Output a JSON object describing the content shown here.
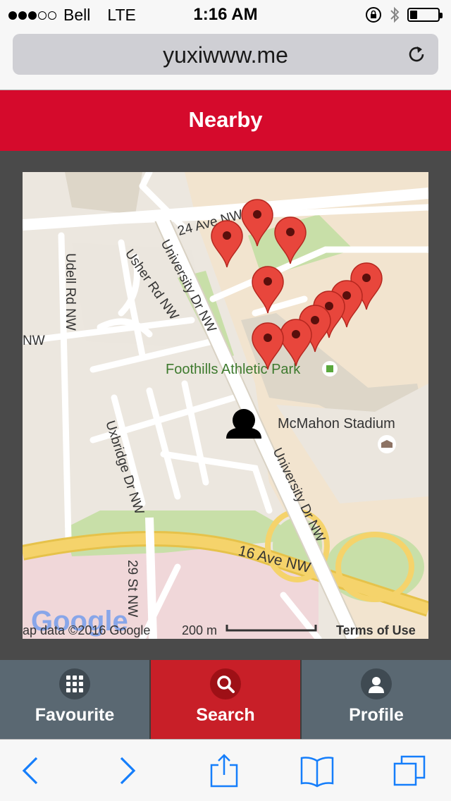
{
  "status_bar": {
    "carrier": "Bell",
    "network": "LTE",
    "time": "1:16 AM",
    "battery_level": 0.25
  },
  "browser": {
    "url": "yuxiwww.me"
  },
  "header": {
    "title": "Nearby"
  },
  "map": {
    "labels": {
      "road_24_ave": "24 Ave NW",
      "road_usher": "Usher Rd NW",
      "road_university_upper": "University Dr NW",
      "road_university_lower": "University Dr NW",
      "road_udell": "Udell Rd NW",
      "road_nw": "NW",
      "road_uxbridge": "Uxbridge Dr NW",
      "road_16_ave": "16 Ave NW",
      "road_29_st": "29 St NW",
      "park": "Foothills Athletic Park",
      "stadium": "McMahon Stadium"
    },
    "footer": {
      "logo": "Google",
      "attribution": "ap data ©2016 Google",
      "scale": "200 m",
      "terms": "Terms of Use"
    },
    "marker_count": 10,
    "colors": {
      "marker": "#e8463c",
      "park": "#c8dfa8",
      "highway": "#f5d36b"
    }
  },
  "tabs": [
    {
      "label": "Favourite",
      "icon": "grid-icon",
      "active": false
    },
    {
      "label": "Search",
      "icon": "search-icon",
      "active": true
    },
    {
      "label": "Profile",
      "icon": "person-icon",
      "active": false
    }
  ],
  "toolbar": {
    "icons": [
      "back-arrow-icon",
      "forward-arrow-icon",
      "share-icon",
      "bookmarks-icon",
      "tabs-icon"
    ]
  },
  "colors": {
    "accent": "#d50a2c",
    "tab_inactive": "#5a6872",
    "tab_active": "#c81f28",
    "ios_blue": "#157efb"
  }
}
